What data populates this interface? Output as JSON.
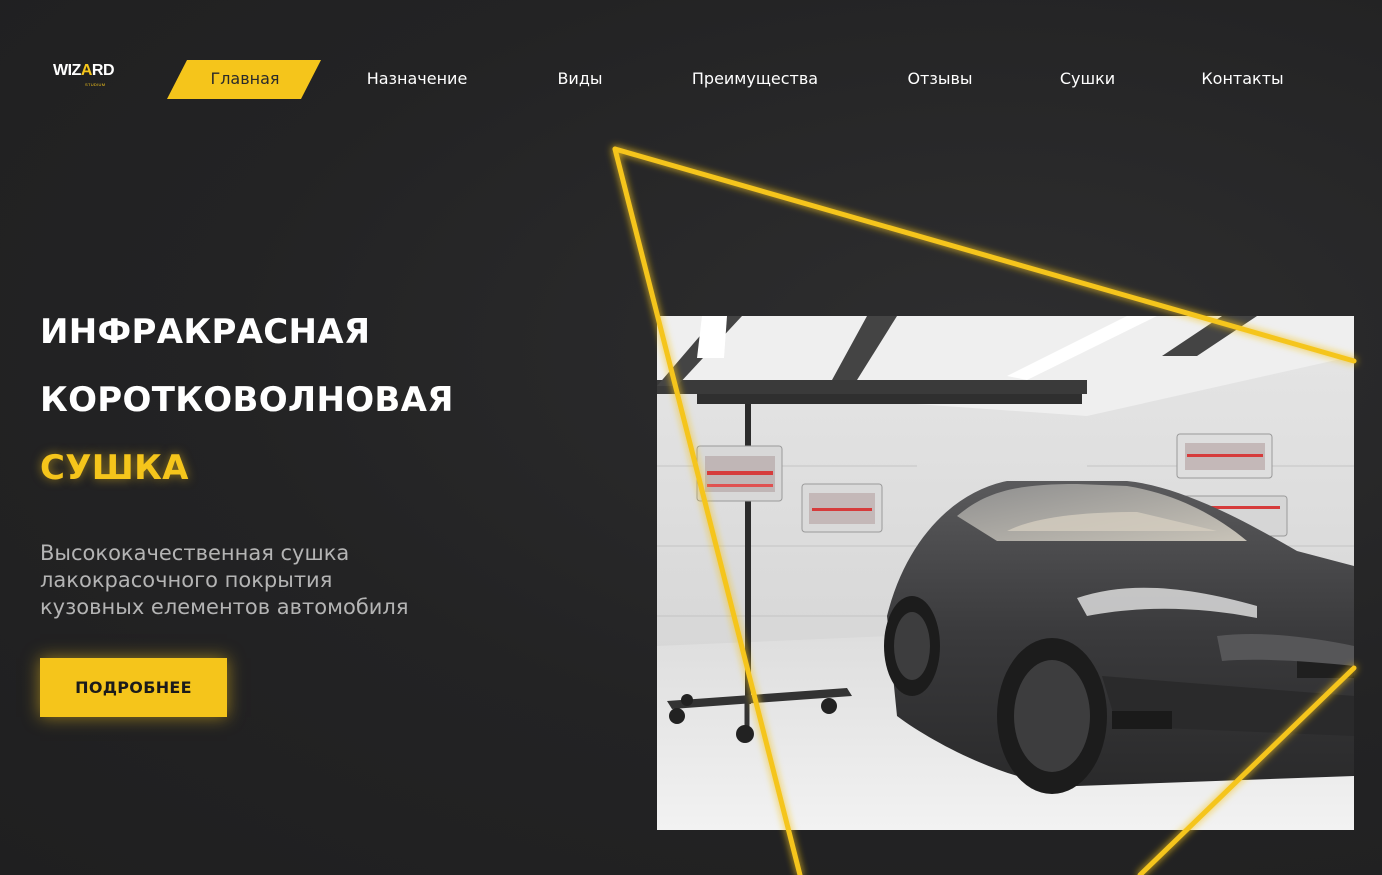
{
  "brand": {
    "logo_text_pre": "WIZ",
    "logo_text_a": "A",
    "logo_text_post": "RD",
    "logo_sub": "STUDIUM"
  },
  "nav": {
    "items": [
      {
        "label": "Главная",
        "active": true
      },
      {
        "label": "Назначение",
        "active": false
      },
      {
        "label": "Виды",
        "active": false
      },
      {
        "label": "Преимущества",
        "active": false
      },
      {
        "label": "Отзывы",
        "active": false
      },
      {
        "label": "Сушки",
        "active": false
      },
      {
        "label": "Контакты",
        "active": false
      }
    ]
  },
  "hero": {
    "title_line1": "ИНФРАКРАСНАЯ",
    "title_line2": "КОРОТКОВОЛНОВАЯ",
    "title_line3": "СУШКА",
    "description_lines": [
      "Высококачественная сушка",
      "лакокрасочного покрытия",
      "кузовных елементов автомобиля"
    ],
    "cta_label": "ПОДРОБНЕЕ"
  },
  "image": {
    "icon": "car-in-drying-booth-photo"
  },
  "colors": {
    "accent": "#f5c51b",
    "background": "#232324",
    "text": "#ffffff",
    "muted_text": "#b4b4b4"
  }
}
